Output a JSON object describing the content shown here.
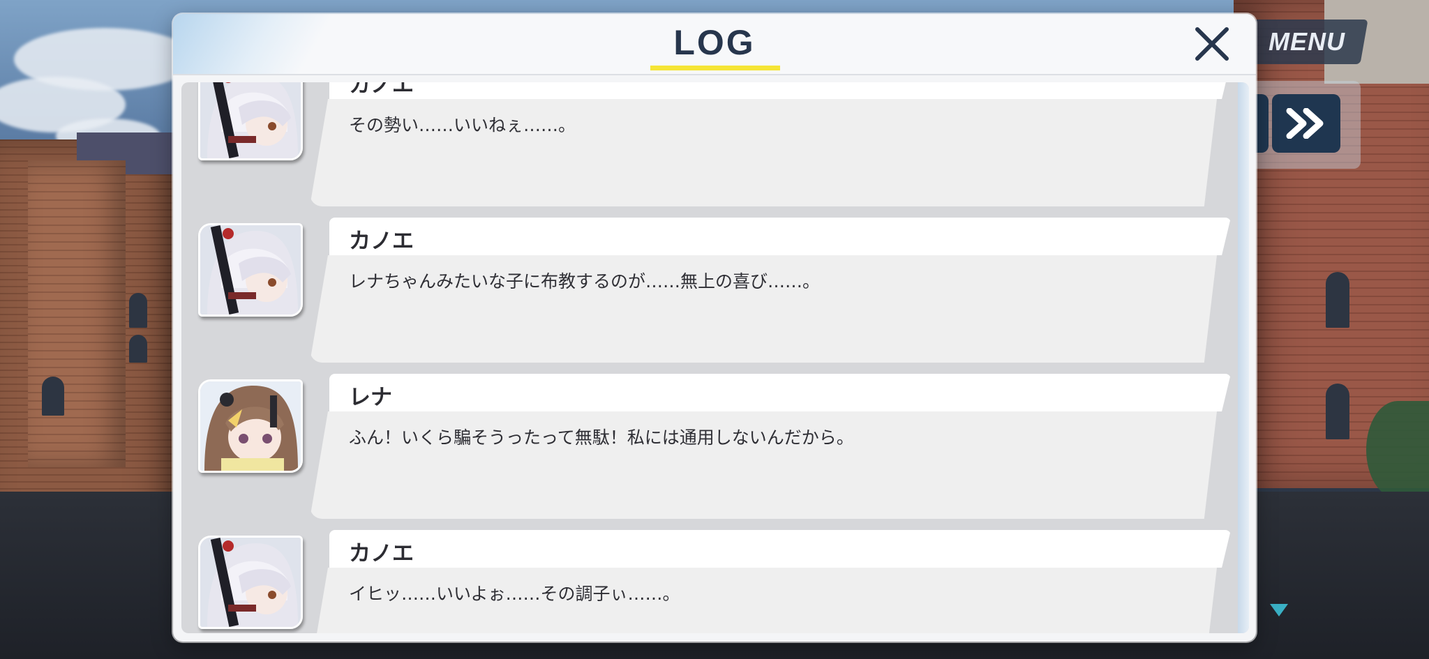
{
  "hud": {
    "menu_label": "MENU"
  },
  "log_panel": {
    "title": "LOG",
    "entries": [
      {
        "speaker": "カノエ",
        "text": "その勢い……いいねぇ……。",
        "avatar": "kanoe"
      },
      {
        "speaker": "カノエ",
        "text": "レナちゃんみたいな子に布教するのが……無上の喜び……。",
        "avatar": "kanoe"
      },
      {
        "speaker": "レナ",
        "text": "ふん！いくら騙そうったって無駄！私には通用しないんだから。",
        "avatar": "rena"
      },
      {
        "speaker": "カノエ",
        "text": "イヒッ……いいよぉ……その調子ぃ……。",
        "avatar": "kanoe"
      }
    ]
  },
  "colors": {
    "accent_underline": "#f5e536",
    "title_text": "#27364d",
    "hud_dark": "#1f3650"
  },
  "icons": {
    "close": "close-icon",
    "fast_forward": "double-chevron-right-icon",
    "next": "triangle-down-icon"
  }
}
